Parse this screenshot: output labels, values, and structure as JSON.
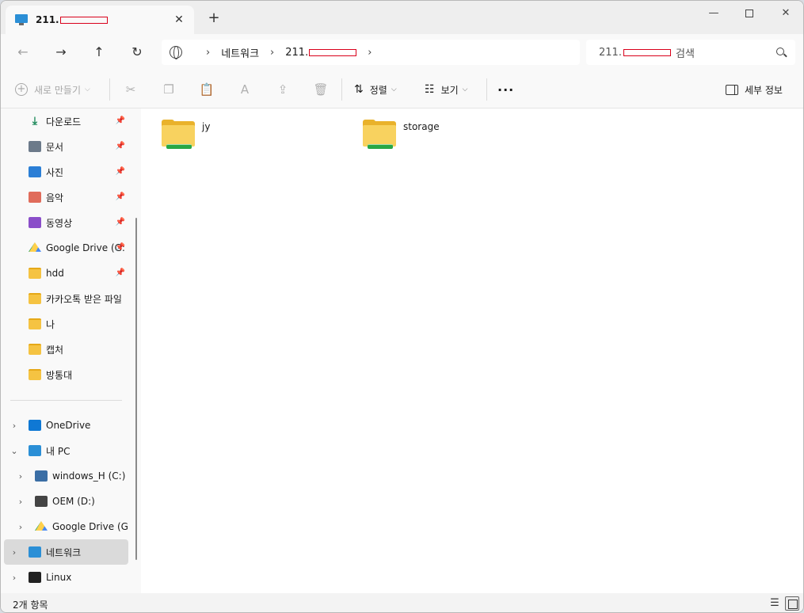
{
  "tab": {
    "title": "211.",
    "close": "✕",
    "new": "+"
  },
  "window": {
    "minimize": "—",
    "close": "✕"
  },
  "nav": {
    "back": "←",
    "forward": "→",
    "up": "↑",
    "refresh": "↻"
  },
  "breadcrumb": {
    "sep": "›",
    "items": [
      "네트워크",
      "211."
    ]
  },
  "search": {
    "value": "211.",
    "suffix": "검색"
  },
  "commandbar": {
    "new_label": "새로 만들기",
    "cut_icon": "✂",
    "copy_icon": "❐",
    "paste_icon": "📋",
    "rename_icon": "A",
    "share_icon": "⇪",
    "delete_icon": "🗑",
    "sort_label": "정렬",
    "view_label": "보기",
    "more_label": "···",
    "details_label": "세부 정보"
  },
  "sidebar": {
    "quick_access": [
      {
        "label": "다운로드",
        "icon": "download-icon",
        "pinned": true
      },
      {
        "label": "문서",
        "icon": "document-icon",
        "pinned": true
      },
      {
        "label": "사진",
        "icon": "pictures-icon",
        "pinned": true
      },
      {
        "label": "음악",
        "icon": "music-icon",
        "pinned": true
      },
      {
        "label": "동영상",
        "icon": "video-icon",
        "pinned": true
      },
      {
        "label": "Google Drive (G:",
        "icon": "google-drive-icon",
        "pinned": true
      },
      {
        "label": "hdd",
        "icon": "folder-icon",
        "pinned": true
      },
      {
        "label": "카카오톡 받은 파일",
        "icon": "folder-icon",
        "pinned": false
      },
      {
        "label": "나",
        "icon": "folder-icon",
        "pinned": false
      },
      {
        "label": "캡처",
        "icon": "folder-icon",
        "pinned": false
      },
      {
        "label": "방통대",
        "icon": "folder-icon",
        "pinned": false
      }
    ],
    "tree": [
      {
        "label": "OneDrive",
        "icon": "onedrive-icon"
      },
      {
        "label": "내 PC",
        "icon": "pc-icon"
      },
      {
        "label": "windows_H (C:)",
        "icon": "windows-drive-icon"
      },
      {
        "label": "OEM (D:)",
        "icon": "drive-icon"
      },
      {
        "label": "Google Drive (G:)",
        "icon": "google-drive-icon"
      },
      {
        "label": "네트워크",
        "icon": "network-icon"
      },
      {
        "label": "Linux",
        "icon": "linux-icon"
      }
    ]
  },
  "files": [
    {
      "name": "jy",
      "icon": "shared-folder-icon"
    },
    {
      "name": "storage",
      "icon": "shared-folder-icon"
    }
  ],
  "status": {
    "count": "2개 항목"
  }
}
